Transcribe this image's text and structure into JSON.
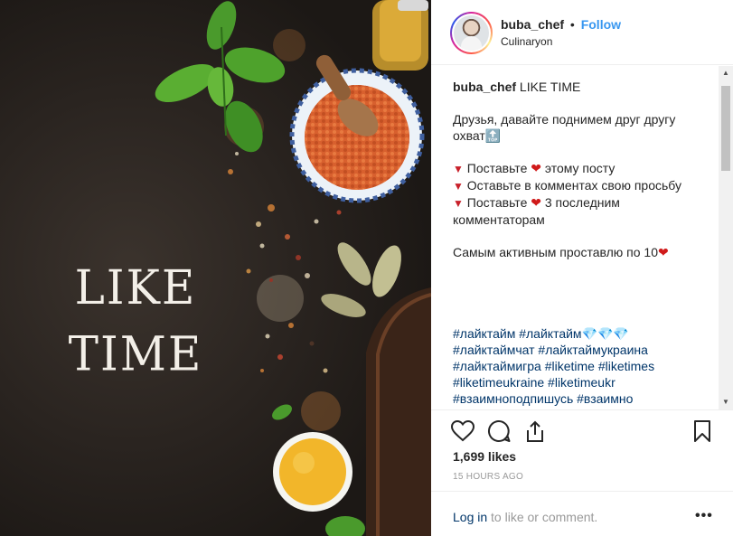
{
  "photo": {
    "caption_line1": "LIKE",
    "caption_line2": "TIME"
  },
  "header": {
    "username": "buba_chef",
    "separator": "•",
    "follow_label": "Follow",
    "location": "Culinaryon"
  },
  "caption": {
    "username": "buba_chef",
    "title": "LIKE TIME",
    "intro": "Друзья, давайте поднимем друг другу охват🔝",
    "list": [
      {
        "marker": "▼",
        "before": "Поставьте ",
        "heart": "❤",
        "after": " этому посту"
      },
      {
        "marker": "▼",
        "before": "Оставьте в комментах свою просьбу",
        "heart": "",
        "after": ""
      },
      {
        "marker": "▼",
        "before": "Поставьте ",
        "heart": "❤",
        "after": " 3 последним комментаторам"
      }
    ],
    "outro": "Самым активным проставлю по 10",
    "outro_heart": "❤",
    "hashtags": [
      "#лайктайм #лайктайм💎💎💎",
      "#лайктаймчат #лайктаймукраина",
      "#лайктаймигра #liketime #liketimes",
      "#liketimeukraine #liketimeukr",
      "#взаимноподпишусь #взаимно"
    ]
  },
  "actions": {
    "likes": "1,699 likes",
    "time": "15 HOURS AGO",
    "login_link": "Log in",
    "login_rest": " to like or comment.",
    "more": "•••"
  },
  "colors": {
    "link_blue": "#3897f0",
    "hashtag": "#003569",
    "heart": "#d01a1a",
    "text": "#262626",
    "muted": "#999999"
  },
  "icons": [
    "heart-icon",
    "comment-icon",
    "share-icon",
    "bookmark-icon",
    "more-icon"
  ]
}
